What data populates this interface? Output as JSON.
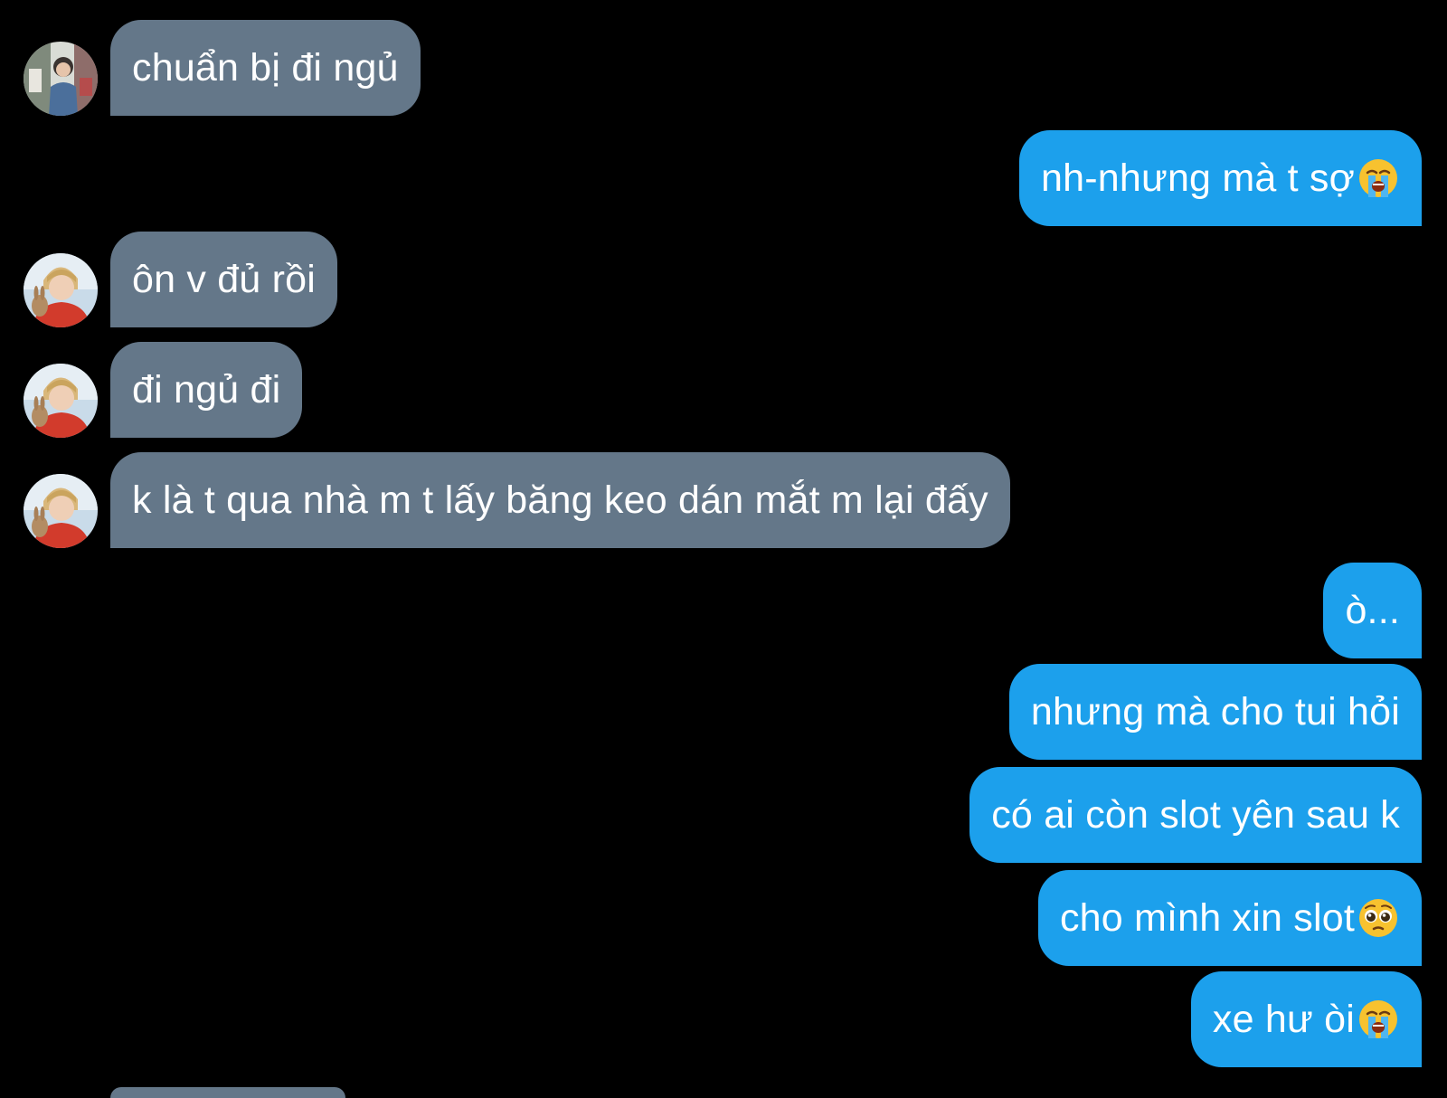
{
  "conversation": {
    "messages": [
      {
        "side": "in",
        "text": "chuẩn bị đi ngủ",
        "avatar": "avatar-contact-1"
      },
      {
        "side": "out",
        "text": "nh-nhưng mà t sợ",
        "emoji": "loudly-crying-face-icon"
      },
      {
        "side": "in",
        "text": "ôn v đủ rồi",
        "avatar": "avatar-contact-2"
      },
      {
        "side": "in",
        "text": "đi ngủ đi",
        "avatar": "avatar-contact-2"
      },
      {
        "side": "in",
        "text": "k là t qua nhà m t lấy băng keo dán mắt m lại đấy",
        "avatar": "avatar-contact-2"
      },
      {
        "side": "out",
        "text": "ò..."
      },
      {
        "side": "out",
        "text": "nhưng mà cho tui hỏi"
      },
      {
        "side": "out",
        "text": "có ai còn slot yên sau k"
      },
      {
        "side": "out",
        "text": "cho mình xin slot",
        "emoji": "pleading-face-icon"
      },
      {
        "side": "out",
        "text": "xe hư òi",
        "emoji": "loudly-crying-face-icon"
      }
    ]
  },
  "colors": {
    "background": "#000000",
    "incoming_bubble": "#647789",
    "outgoing_bubble": "#1ca0ec",
    "text": "#ffffff"
  }
}
